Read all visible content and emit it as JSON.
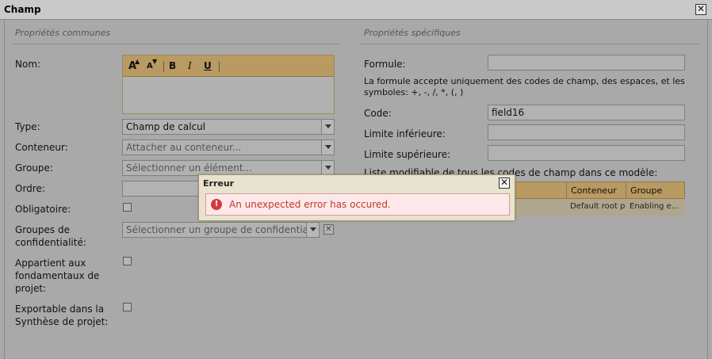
{
  "window": {
    "title": "Champ",
    "close_symbol": "✕"
  },
  "common": {
    "section_title": "Propriétés communes",
    "nom_label": "Nom:",
    "editor_toolbar": {
      "bold": "B",
      "italic": "I",
      "underline": "U",
      "grow": "A",
      "shrink": "A"
    },
    "type_label": "Type:",
    "type_value": "Champ de calcul",
    "conteneur_label": "Conteneur:",
    "conteneur_placeholder": "Attacher au conteneur...",
    "groupe_label": "Groupe:",
    "groupe_placeholder": "Sélectionner un élément...",
    "ordre_label": "Ordre:",
    "obligatoire_label": "Obligatoire:",
    "confidentialite_label": "Groupes de confidentialité:",
    "confidentialite_placeholder": "Sélectionner un groupe de confidentialité",
    "fondamentaux_label": "Appartient aux fondamentaux de projet:",
    "exportable_label": "Exportable dans la Synthèse de projet:"
  },
  "specific": {
    "section_title": "Propriétés spécifiques",
    "formule_label": "Formule:",
    "formule_help": "La formule accepte uniquement des codes de champ, des espaces, et les symboles: +, -, /, *, (, )",
    "code_label": "Code:",
    "code_value": "field16",
    "limite_inf_label": "Limite inférieure:",
    "limite_sup_label": "Limite supérieure:",
    "list_label": "Liste modifiable de tous les codes de champ dans ce modèle:",
    "table": {
      "headers": [
        "Conteneur",
        "Groupe"
      ],
      "row": [
        "Default root pl",
        "Enabling e..."
      ]
    }
  },
  "error_dialog": {
    "title": "Erreur",
    "close_symbol": "✕",
    "icon": "!",
    "message": "An unexpected error has occured."
  }
}
